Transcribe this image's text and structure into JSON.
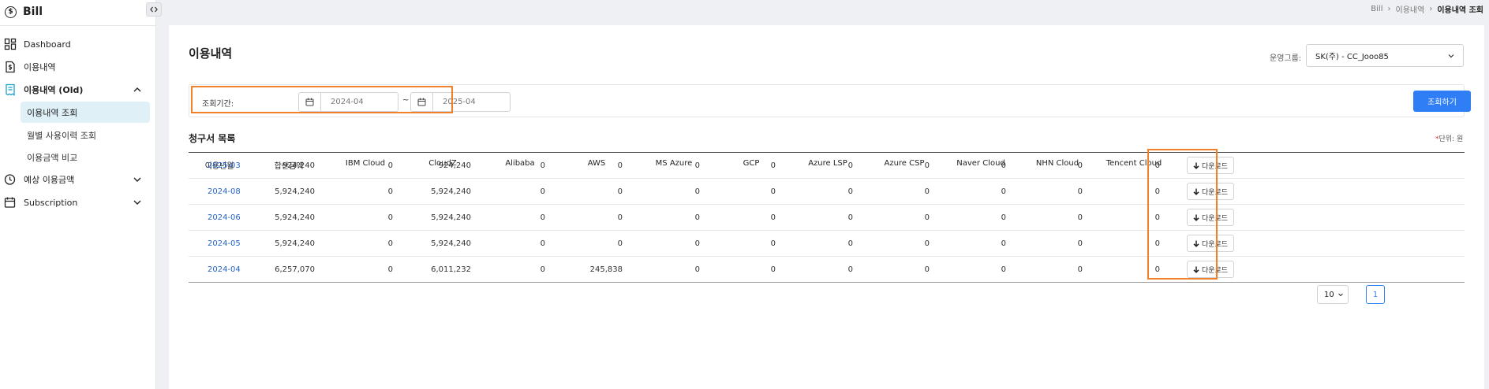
{
  "app": {
    "name": "Bill",
    "logo_glyph": "$"
  },
  "breadcrumb": [
    "Bill",
    "›",
    "이용내역",
    "›",
    "이용내역 조회"
  ],
  "sidebar": {
    "items": [
      {
        "label": "Dashboard",
        "icon": "dashboard-icon"
      },
      {
        "label": "이용내역",
        "icon": "invoice-dollar-icon"
      },
      {
        "label": "이용내역 (Old)",
        "icon": "receipt-icon",
        "expanded": true
      },
      {
        "label": "예상 이용금액",
        "icon": "clock-dollar-icon"
      },
      {
        "label": "Subscription",
        "icon": "calendar-icon"
      }
    ],
    "subitems": [
      {
        "label": "이용내역 조회",
        "active": true
      },
      {
        "label": "월별 사용이력 조회"
      },
      {
        "label": "이용금액 비교"
      }
    ]
  },
  "page": {
    "title": "이용내역",
    "group_label": "운영그룹:",
    "group_value": "SK(주) - CC_Jooo85"
  },
  "filter": {
    "period_label": "조회기간:",
    "start": "2024-04",
    "separator": "~",
    "end": "2025-04",
    "search_label": "조회하기"
  },
  "list": {
    "title": "청구서 목록",
    "unit_star": "*",
    "unit": "단위: 원",
    "columns": [
      "이용년월",
      "합산금액",
      "IBM Cloud",
      "CloudZ",
      "Alibaba",
      "AWS",
      "MS Azure",
      "GCP",
      "Azure LSP",
      "Azure CSP",
      "Naver Cloud",
      "NHN Cloud",
      "Tencent Cloud",
      "다운로드"
    ],
    "rows": [
      [
        "2025-03",
        "924,240",
        "0",
        "924,240",
        "0",
        "0",
        "0",
        "0",
        "0",
        "0",
        "0",
        "0",
        "0"
      ],
      [
        "2024-08",
        "5,924,240",
        "0",
        "5,924,240",
        "0",
        "0",
        "0",
        "0",
        "0",
        "0",
        "0",
        "0",
        "0"
      ],
      [
        "2024-06",
        "5,924,240",
        "0",
        "5,924,240",
        "0",
        "0",
        "0",
        "0",
        "0",
        "0",
        "0",
        "0",
        "0"
      ],
      [
        "2024-05",
        "5,924,240",
        "0",
        "5,924,240",
        "0",
        "0",
        "0",
        "0",
        "0",
        "0",
        "0",
        "0",
        "0"
      ],
      [
        "2024-04",
        "6,257,070",
        "0",
        "6,011,232",
        "0",
        "245,838",
        "0",
        "0",
        "0",
        "0",
        "0",
        "0",
        "0"
      ]
    ],
    "download_label": "다운로드"
  },
  "pagination": {
    "page_size": "10",
    "current_page": "1"
  },
  "colors": {
    "accent": "#2f7ef5",
    "highlight": "#f0802a",
    "link": "#2563c9",
    "active_bg": "#dff0f7"
  }
}
